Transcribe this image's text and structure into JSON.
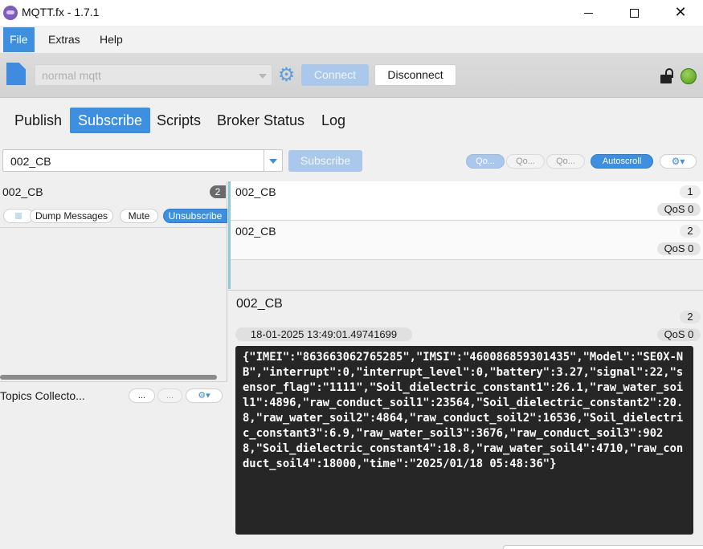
{
  "window": {
    "title": "MQTT.fx - 1.7.1"
  },
  "menu": {
    "items": [
      "File",
      "Extras",
      "Help"
    ]
  },
  "toolbar": {
    "profile": "normal mqtt",
    "connect_label": "Connect",
    "disconnect_label": "Disconnect",
    "connection_status_color": "#5fa828"
  },
  "tabs": [
    "Publish",
    "Subscribe",
    "Scripts",
    "Broker Status",
    "Log"
  ],
  "subscribe_bar": {
    "topic_value": "002_CB",
    "subscribe_label": "Subscribe",
    "qos_buttons": [
      "Qo...",
      "Qo...",
      "Qo..."
    ],
    "autoscroll_label": "Autoscroll",
    "settings_icon": "gear-dropdown-icon"
  },
  "subscriptions": [
    {
      "topic": "002_CB",
      "count": "2",
      "dump_label": "Dump Messages",
      "mute_label": "Mute",
      "unsubscribe_label": "Unsubscribe"
    }
  ],
  "collector": {
    "label": "Topics Collecto...",
    "buttons": [
      "...",
      "..."
    ]
  },
  "messages": [
    {
      "topic": "002_CB",
      "number": "1",
      "qos": "QoS 0"
    },
    {
      "topic": "002_CB",
      "number": "2",
      "qos": "QoS 0"
    }
  ],
  "detail": {
    "topic": "002_CB",
    "number": "2",
    "timestamp": "18-01-2025  13:49:01.49741699",
    "qos": "QoS 0",
    "payload": "{\"IMEI\":\"863663062765285\",\"IMSI\":\"460086859301435\",\"Model\":\"SE0X-NB\",\"interrupt\":0,\"interrupt_level\":0,\"battery\":3.27,\"signal\":22,\"sensor_flag\":\"1111\",\"Soil_dielectric_constant1\":26.1,\"raw_water_soil1\":4896,\"raw_conduct_soil1\":23564,\"Soil_dielectric_constant2\":20.8,\"raw_water_soil2\":4864,\"raw_conduct_soil2\":16536,\"Soil_dielectric_constant3\":6.9,\"raw_water_soil3\":3676,\"raw_conduct_soil3\":9028,\"Soil_dielectric_constant4\":18.8,\"raw_water_soil4\":4710,\"raw_conduct_soil4\":18000,\"time\":\"2025/01/18 05:48:36\"}"
  }
}
